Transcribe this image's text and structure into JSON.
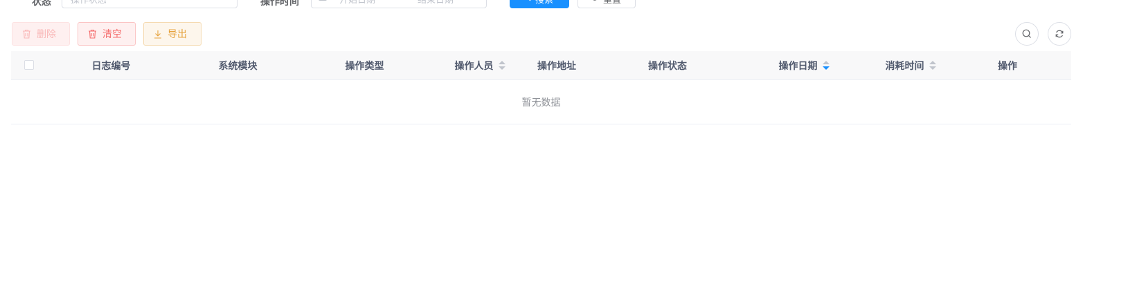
{
  "search": {
    "status_label": "状态",
    "status_placeholder": "操作状态",
    "time_label": "操作时间",
    "start_placeholder": "开始日期",
    "separator": "-",
    "end_placeholder": "结束日期",
    "search_button": "搜索",
    "reset_button": "重置"
  },
  "toolbar": {
    "delete_label": "删除",
    "clear_label": "清空",
    "export_label": "导出",
    "search_toggle_icon": "search-icon",
    "refresh_icon": "refresh-icon"
  },
  "table": {
    "columns": [
      {
        "label": "日志编号",
        "sortable": false
      },
      {
        "label": "系统模块",
        "sortable": false
      },
      {
        "label": "操作类型",
        "sortable": false
      },
      {
        "label": "操作人员",
        "sortable": true,
        "sort": "none"
      },
      {
        "label": "操作地址",
        "sortable": false
      },
      {
        "label": "操作状态",
        "sortable": false
      },
      {
        "label": "操作日期",
        "sortable": true,
        "sort": "descending"
      },
      {
        "label": "消耗时间",
        "sortable": true,
        "sort": "none"
      },
      {
        "label": "操作",
        "sortable": false
      }
    ],
    "empty_text": "暂无数据"
  },
  "colors": {
    "primary": "#1890ff",
    "danger": "#f56c6c",
    "warning": "#e6a23c",
    "header_bg": "#f8f8f9"
  }
}
